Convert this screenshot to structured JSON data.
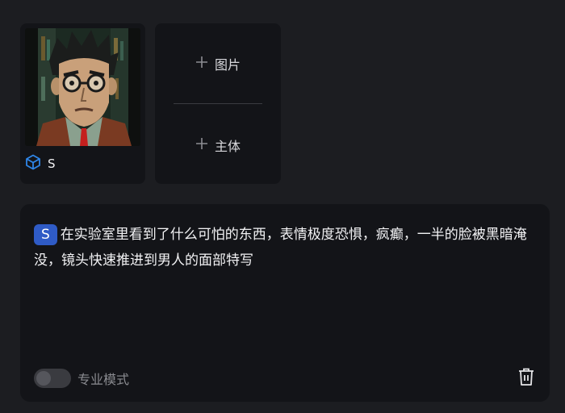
{
  "subject": {
    "name": "S",
    "icon": "cube-icon",
    "accent": "#2f86e8"
  },
  "add_panel": {
    "image_label": "图片",
    "subject_label": "主体",
    "icon": "plus-icon"
  },
  "prompt": {
    "tag": "S",
    "text": "在实验室里看到了什么可怕的东西，表情极度恐惧，疯癫，一半的脸被黑暗淹没，镜头快速推进到男人的面部特写",
    "tag_color": "#2f5bc6"
  },
  "footer": {
    "pro_mode_label": "专业模式",
    "pro_mode_on": false,
    "delete_icon": "trash-icon"
  }
}
